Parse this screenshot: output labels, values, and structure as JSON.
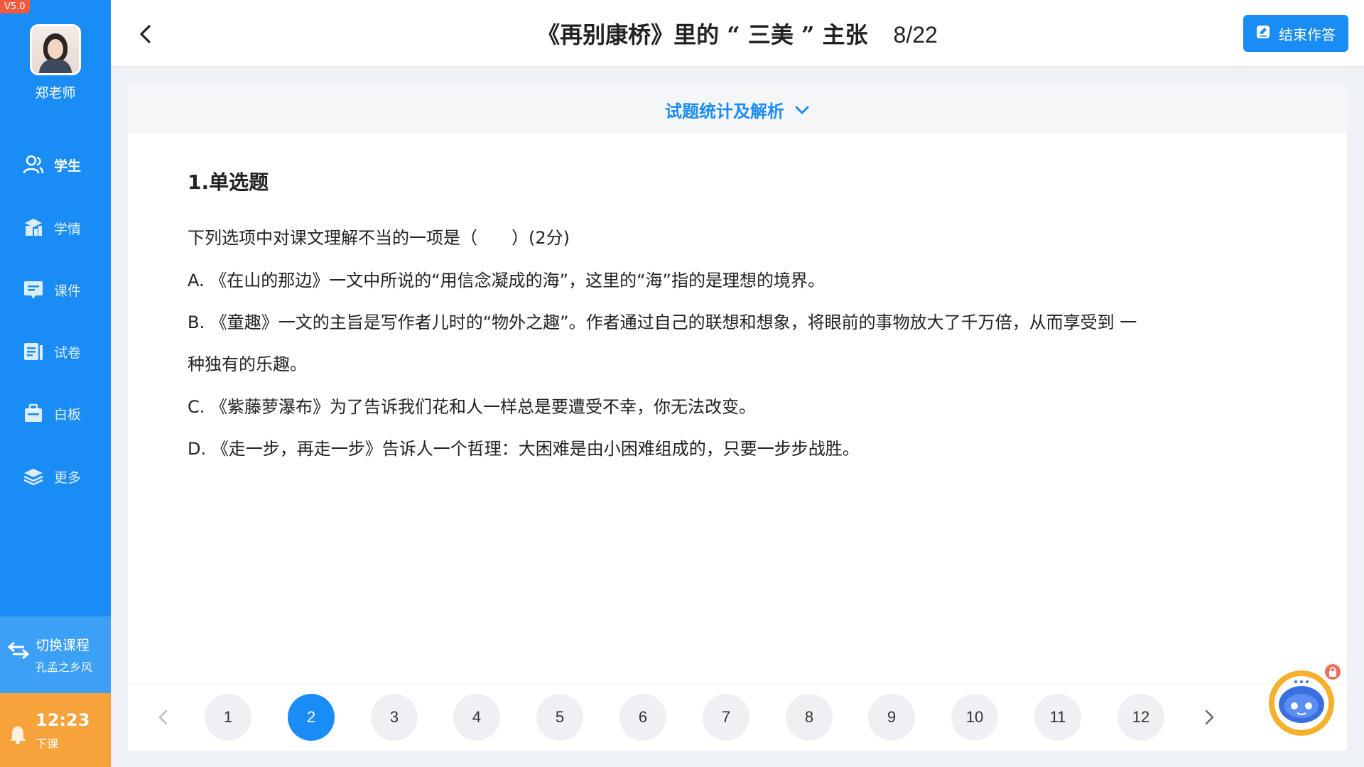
{
  "app": {
    "version": "V5.0"
  },
  "sidebar": {
    "teacher_name": "郑老师",
    "items": [
      {
        "label": "学生",
        "icon": "students-icon",
        "active": true
      },
      {
        "label": "学情",
        "icon": "analytics-icon",
        "active": false
      },
      {
        "label": "课件",
        "icon": "courseware-icon",
        "active": false
      },
      {
        "label": "试卷",
        "icon": "exam-paper-icon",
        "active": false
      },
      {
        "label": "白板",
        "icon": "whiteboard-icon",
        "active": false
      },
      {
        "label": "更多",
        "icon": "layers-icon",
        "active": false
      }
    ],
    "switch_course": {
      "title": "切换课程",
      "subtitle": "孔孟之乡风"
    },
    "clock": {
      "time": "12:23",
      "status": "下课"
    }
  },
  "header": {
    "title": "《再别康桥》里的 “ 三美 ” 主张",
    "progress": "8/22",
    "end_button": "结束作答"
  },
  "stats_bar": {
    "label": "试题统计及解析"
  },
  "question": {
    "type": "1.单选题",
    "stem": "下列选项中对课文理解不当的一项是（　　）(2分)",
    "lines": [
      "A.  《在山的那边》一文中所说的“用信念凝成的海”，这里的“海”指的是理想的境界。",
      "B.  《童趣》一文的主旨是写作者儿时的“物外之趣”。作者通过自己的联想和想象，将眼前的事物放大了千万倍，从而享受到 一",
      "种独有的乐趣。",
      "C.  《紫藤萝瀑布》为了告诉我们花和人一样总是要遭受不幸，你无法改变。",
      "D.  《走一步，再走一步》告诉人一个哲理：大困难是由小困难组成的，只要一步步战胜。"
    ]
  },
  "pager": {
    "pages": [
      "1",
      "2",
      "3",
      "4",
      "5",
      "6",
      "7",
      "8",
      "9",
      "10",
      "11",
      "12"
    ],
    "active": "2"
  },
  "colors": {
    "primary": "#1a8cf5",
    "clock": "#f7a23a",
    "version_badge": "#f05a3c"
  }
}
